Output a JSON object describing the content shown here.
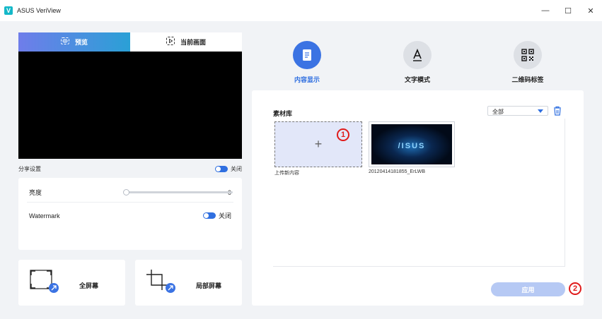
{
  "window": {
    "title": "ASUS VeriView",
    "minimize": "—",
    "maximize": "☐",
    "close": "✕"
  },
  "preview": {
    "tabs": [
      {
        "label": "预览"
      },
      {
        "label": "当前画面"
      }
    ],
    "share_label": "分享设置",
    "share_state": "关闭"
  },
  "settings": {
    "brightness_label": "亮度",
    "brightness_value": "0",
    "brightness_level": 0,
    "watermark_label": "Watermark",
    "watermark_state": "关闭"
  },
  "buttons": {
    "fullscreen": "全屏幕",
    "partial": "局部屏幕"
  },
  "modes": [
    {
      "label": "内容显示",
      "icon": "document-icon",
      "active": true
    },
    {
      "label": "文字模式",
      "icon": "text-a-icon",
      "active": false
    },
    {
      "label": "二维码标签",
      "icon": "qrcode-icon",
      "active": false
    }
  ],
  "library": {
    "title": "素材库",
    "filter_value": "全部",
    "upload_caption": "上传新内容",
    "items": [
      {
        "caption": "20120414181855_ErLWB",
        "logo_text": "/ISUS"
      }
    ],
    "apply_label": "应用"
  },
  "markers": {
    "one": "1",
    "two": "2"
  },
  "colors": {
    "accent": "#2f6fe0",
    "marker": "#e01b1b"
  }
}
